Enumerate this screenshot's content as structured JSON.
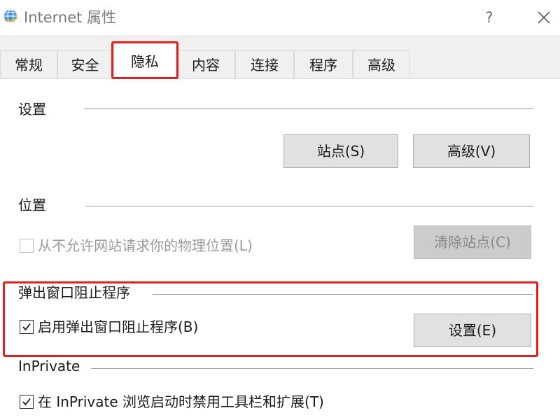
{
  "window": {
    "title": "Internet 属性",
    "help_glyph": "?"
  },
  "tabs": [
    {
      "label": "常规"
    },
    {
      "label": "安全"
    },
    {
      "label": "隐私",
      "active": true
    },
    {
      "label": "内容"
    },
    {
      "label": "连接"
    },
    {
      "label": "程序"
    },
    {
      "label": "高级"
    }
  ],
  "settings_section": {
    "label": "设置",
    "sites_button": "站点(S)",
    "advanced_button": "高级(V)"
  },
  "location_section": {
    "label": "位置",
    "never_allow_label": "从不允许网站请求你的物理位置(L)",
    "never_allow_checked": false,
    "clear_sites_button": "清除站点(C)"
  },
  "popup_section": {
    "label": "弹出窗口阻止程序",
    "enable_label": "启用弹出窗口阻止程序(B)",
    "enable_checked": true,
    "settings_button": "设置(E)"
  },
  "inprivate_section": {
    "label": "InPrivate",
    "disable_toolbars_label": "在 InPrivate 浏览启动时禁用工具栏和扩展(T)",
    "disable_toolbars_checked": true
  },
  "colors": {
    "highlight": "#e02020",
    "tab_bg": "#f0f0f0",
    "button_bg": "#e1e1e1",
    "disabled_button_bg": "#cccccc"
  },
  "icons": {
    "app": "ie-globe-icon",
    "close": "close-icon",
    "checkmark": "checkmark-icon"
  }
}
